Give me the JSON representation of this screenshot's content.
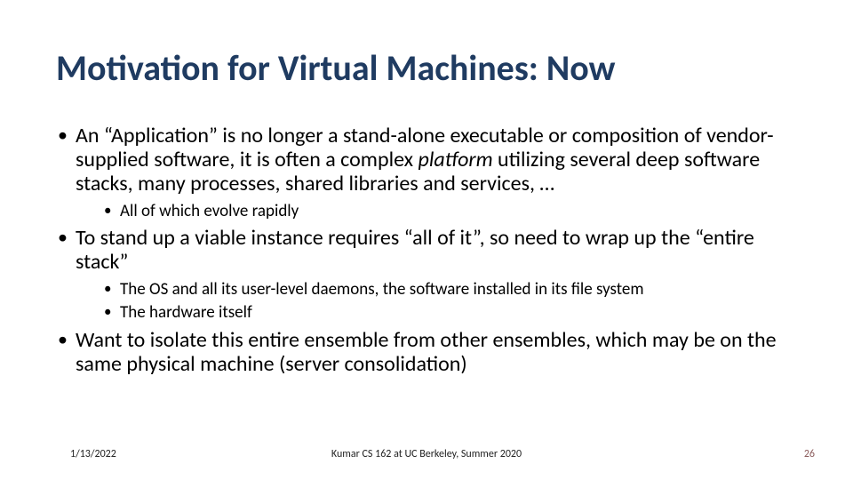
{
  "title": "Motivation for Virtual Machines: Now",
  "bullets": {
    "b1_pre": "An “Application” is no longer a stand-alone executable or composition of vendor-supplied software, it is often a complex ",
    "b1_italic": "platform",
    "b1_post": " utilizing several deep software stacks, many processes, shared libraries and services, …",
    "b1_sub1": "All of which evolve rapidly",
    "b2": "To stand up a viable instance requires “all of it”, so need to wrap up the “entire  stack”",
    "b2_sub1": "The OS and all its user-level daemons, the software installed in its file system",
    "b2_sub2": "The hardware itself",
    "b3": "Want to isolate this entire ensemble from other ensembles, which may be on the same physical machine (server consolidation)"
  },
  "footer": {
    "date": "1/13/2022",
    "center": "Kumar CS 162 at UC Berkeley, Summer 2020",
    "page": "26"
  }
}
